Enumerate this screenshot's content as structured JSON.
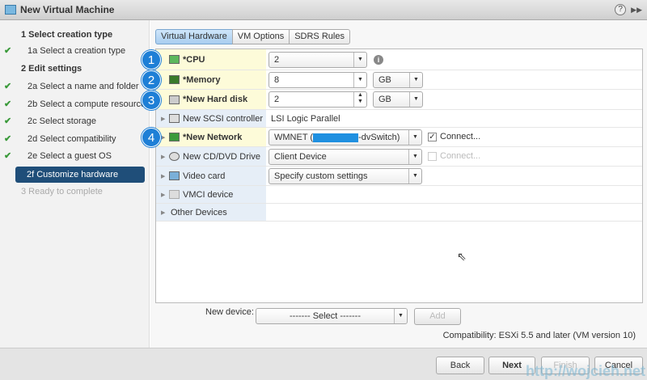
{
  "window": {
    "title": "New Virtual Machine",
    "help_icon": "?",
    "expand_icon": "▶▶"
  },
  "steps": [
    {
      "label": "1  Select creation type",
      "type": "header"
    },
    {
      "label": "1a  Select a creation type",
      "done": true
    },
    {
      "label": "2  Edit settings",
      "type": "header"
    },
    {
      "label": "2a  Select a name and folder",
      "done": true
    },
    {
      "label": "2b  Select a compute resource",
      "done": true
    },
    {
      "label": "2c  Select storage",
      "done": true
    },
    {
      "label": "2d  Select compatibility",
      "done": true
    },
    {
      "label": "2e  Select a guest OS",
      "done": true
    },
    {
      "label": "2f  Customize hardware",
      "active": true
    },
    {
      "label": "3  Ready to complete",
      "disabled": true
    }
  ],
  "tabs": [
    "Virtual Hardware",
    "VM Options",
    "SDRS Rules"
  ],
  "hardware": {
    "cpu": {
      "label": "*CPU",
      "value": "2",
      "badge": "1"
    },
    "memory": {
      "label": "*Memory",
      "value": "8",
      "unit": "GB",
      "badge": "2"
    },
    "disk": {
      "label": "*New Hard disk",
      "value": "2",
      "unit": "GB",
      "badge": "3"
    },
    "scsi": {
      "label": "New SCSI controller",
      "value": "LSI Logic Parallel"
    },
    "network": {
      "label": "*New Network",
      "value_prefix": "WMNET (",
      "value_suffix": "-dvSwitch)",
      "connect": "Connect...",
      "connected": true,
      "badge": "4"
    },
    "cdrom": {
      "label": "New CD/DVD Drive",
      "value": "Client Device",
      "connect": "Connect...",
      "connected": false
    },
    "video": {
      "label": "Video card",
      "value": "Specify custom settings"
    },
    "vmci": {
      "label": "VMCI device"
    },
    "other": {
      "label": "Other Devices"
    }
  },
  "new_device": {
    "label": "New device:",
    "select": "------- Select -------",
    "add": "Add"
  },
  "compatibility": "Compatibility: ESXi 5.5 and later (VM version 10)",
  "buttons": {
    "back": "Back",
    "next": "Next",
    "finish": "Finish",
    "cancel": "Cancel"
  },
  "watermark": "http://wojcieh.net"
}
